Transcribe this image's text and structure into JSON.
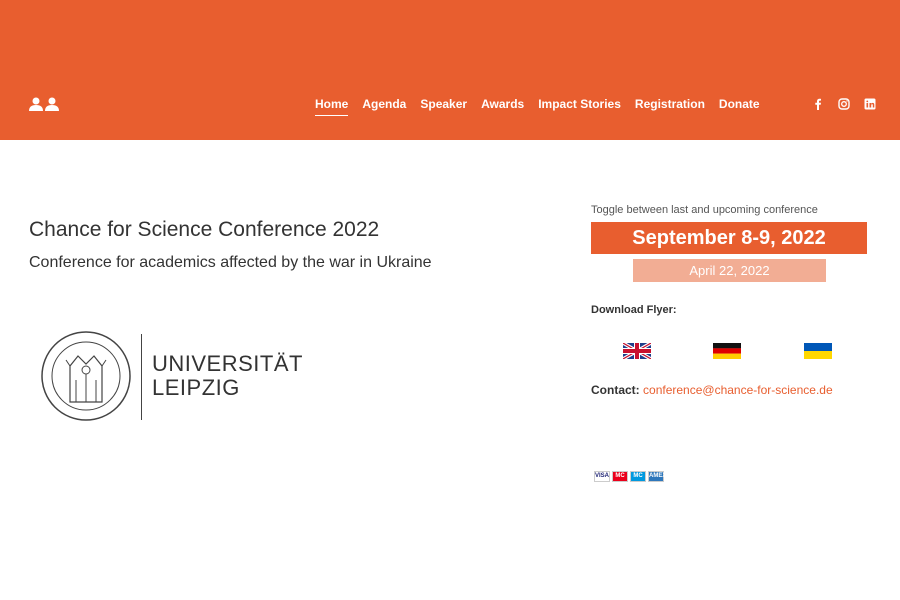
{
  "header": {
    "logo_icon": "people-icon",
    "nav": [
      {
        "label": "Home",
        "active": true
      },
      {
        "label": "Agenda"
      },
      {
        "label": "Speaker"
      },
      {
        "label": "Awards"
      },
      {
        "label": "Impact Stories"
      },
      {
        "label": "Registration"
      },
      {
        "label": "Donate"
      }
    ],
    "social_icons": [
      "facebook-icon",
      "instagram-icon",
      "linkedin-icon"
    ]
  },
  "main": {
    "title": "Chance for Science Conference 2022",
    "subtitle": "Conference for academics affected by the war in Ukraine",
    "university": {
      "line1": "UNIVERSITÄT",
      "line2": "LEIPZIG"
    }
  },
  "sidebar": {
    "toggle_label": "Toggle between last and upcoming conference",
    "date_upcoming": "September 8-9, 2022",
    "date_last": "April 22, 2022",
    "flyer_label": "Download Flyer:",
    "flags": [
      "uk-flag-icon",
      "germany-flag-icon",
      "ukraine-flag-icon"
    ],
    "contact_label": "Contact:",
    "contact_email": "conference@chance-for-science.de",
    "payment_icons": [
      "VISA",
      "MC",
      "MC",
      "AMEX"
    ]
  },
  "colors": {
    "accent": "#e85e2f",
    "accent_light": "#f2ad94"
  }
}
